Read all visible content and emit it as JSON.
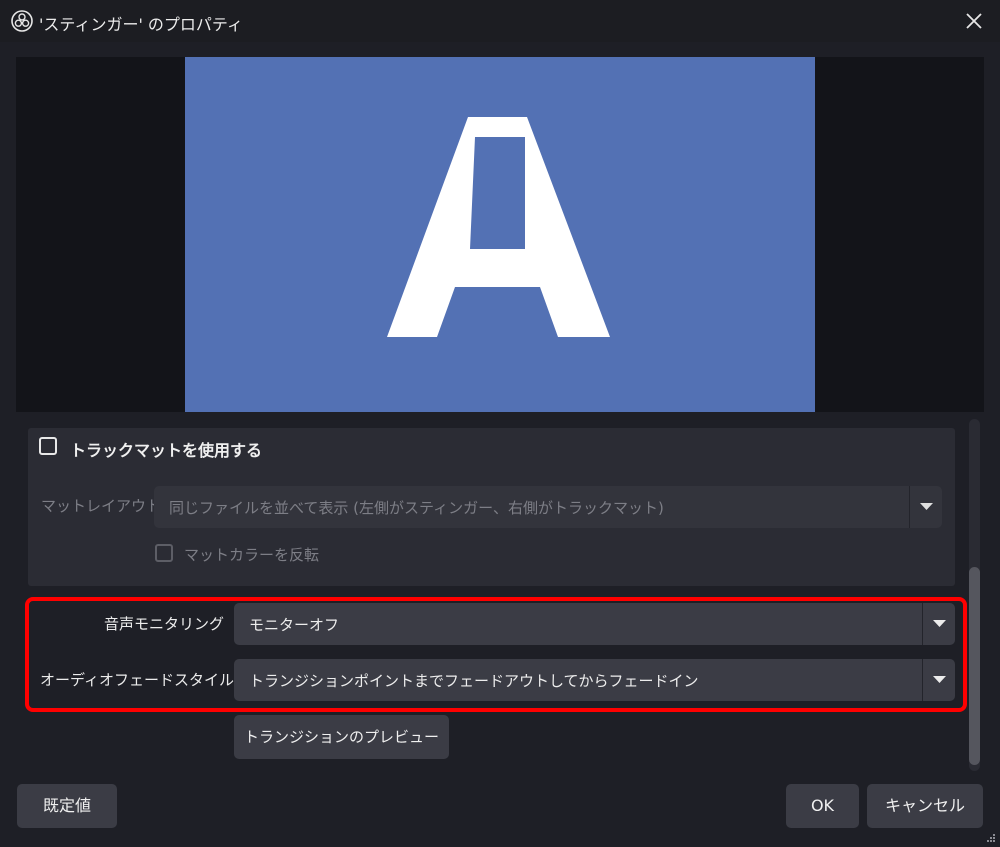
{
  "window": {
    "title": "'スティンガー' のプロパティ",
    "app_icon": "obs-logo-icon",
    "close_icon": "close-icon"
  },
  "preview": {
    "letter": "A",
    "bg_color": "#5371b4"
  },
  "track_matte": {
    "checkbox_label": "トラックマットを使用する",
    "checked": false,
    "matte_layout_label": "マットレイアウト",
    "matte_layout_value": "同じファイルを並べて表示 (左側がスティンガー、右側がトラックマット)",
    "invert_label": "マットカラーを反転",
    "invert_checked": false
  },
  "audio": {
    "monitoring_label": "音声モニタリング",
    "monitoring_value": "モニターオフ",
    "fade_style_label": "オーディオフェードスタイル",
    "fade_style_value": "トランジションポイントまでフェードアウトしてからフェードイン"
  },
  "preview_button": "トランジションのプレビュー",
  "footer": {
    "defaults": "既定値",
    "ok": "OK",
    "cancel": "キャンセル"
  },
  "highlight_color": "#ff0000"
}
